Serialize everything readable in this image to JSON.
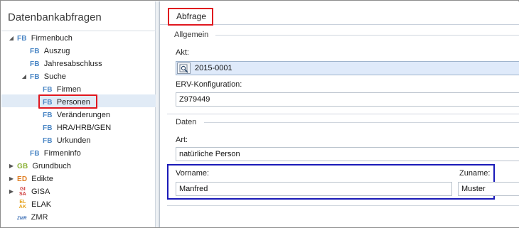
{
  "left_panel": {
    "title": "Datenbankabfragen",
    "tree": [
      {
        "tag": "FB",
        "label": "Firmenbuch",
        "expanded": true
      },
      {
        "tag": "FB",
        "label": "Auszug"
      },
      {
        "tag": "FB",
        "label": "Jahresabschluss"
      },
      {
        "tag": "FB",
        "label": "Suche",
        "expanded": true
      },
      {
        "tag": "FB",
        "label": "Firmen"
      },
      {
        "tag": "FB",
        "label": "Personen",
        "selected": true
      },
      {
        "tag": "FB",
        "label": "Veränderungen"
      },
      {
        "tag": "FB",
        "label": "HRA/HRB/GEN"
      },
      {
        "tag": "FB",
        "label": "Urkunden"
      },
      {
        "tag": "FB",
        "label": "Firmeninfo"
      },
      {
        "tag": "GB",
        "label": "Grundbuch",
        "expanded": false
      },
      {
        "tag": "ED",
        "label": "Edikte",
        "expanded": false
      },
      {
        "tag_top": "GI",
        "tag_bottom": "SA",
        "label": "GISA",
        "expanded": false
      },
      {
        "tag_top": "EL",
        "tag_bottom": "AK",
        "label": "ELAK"
      },
      {
        "tag": "ZMR",
        "label": "ZMR"
      }
    ]
  },
  "right_panel": {
    "tab_label": "Abfrage",
    "sections": {
      "allgemein": {
        "title": "Allgemein",
        "akt_label": "Akt:",
        "akt_value": "2015-0001",
        "erv_label": "ERV-Konfiguration:",
        "erv_value": "Z979449"
      },
      "daten": {
        "title": "Daten",
        "art_label": "Art:",
        "art_value": "natürliche Person",
        "vorname_label": "Vorname:",
        "vorname_value": "Manfred",
        "zuname_label": "Zuname:",
        "zuname_value": "Muster"
      }
    }
  },
  "colors": {
    "fb": "#4a86c5",
    "gb": "#8db33a",
    "ed": "#e07f24",
    "gisa": "#cc3333",
    "elak": "#e6a21a",
    "highlight_red": "#e0171f",
    "highlight_blue": "#1a1ab8",
    "selection": "#e1ebf6"
  },
  "icons": {
    "lookup": "magnifier-document-icon",
    "expanded": "triangle-down-icon",
    "collapsed": "triangle-right-icon"
  }
}
